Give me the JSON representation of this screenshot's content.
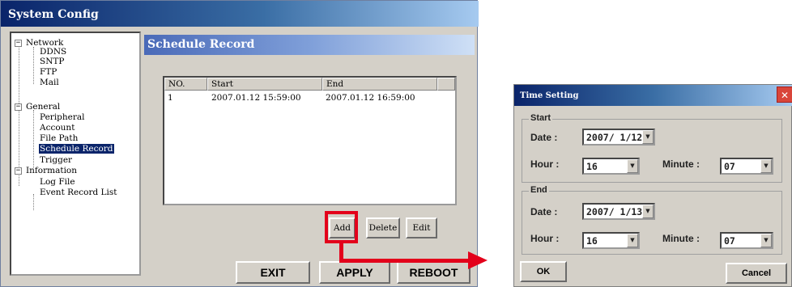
{
  "system_config": {
    "title": "System Config",
    "tree": [
      {
        "label": "Network",
        "level": 0,
        "toggle": "−"
      },
      {
        "label": "DDNS",
        "level": 1
      },
      {
        "label": "SNTP",
        "level": 1
      },
      {
        "label": "FTP",
        "level": 1
      },
      {
        "label": "Mail",
        "level": 1
      },
      {
        "label": "General",
        "level": 0,
        "toggle": "−"
      },
      {
        "label": "Peripheral",
        "level": 1
      },
      {
        "label": "Account",
        "level": 1
      },
      {
        "label": "File Path",
        "level": 1
      },
      {
        "label": "Schedule Record",
        "level": 1,
        "selected": true
      },
      {
        "label": "Trigger",
        "level": 1
      },
      {
        "label": "Information",
        "level": 0,
        "toggle": "−"
      },
      {
        "label": "Log File",
        "level": 1
      },
      {
        "label": "Event Record List",
        "level": 1
      }
    ],
    "panel_title": "Schedule Record",
    "table": {
      "columns": [
        "NO.",
        "Start",
        "End",
        ""
      ],
      "rows": [
        [
          "1",
          "2007.01.12 15:59:00",
          "2007.01.12 16:59:00"
        ]
      ]
    },
    "buttons": {
      "add": "Add",
      "delete": "Delete",
      "edit": "Edit",
      "exit": "EXIT",
      "apply": "APPLY",
      "reboot": "REBOOT"
    },
    "highlight_color": "#e3001b"
  },
  "time_setting": {
    "title": "Time Setting",
    "close": "✕",
    "start": {
      "group_label": "Start",
      "date_label": "Date :",
      "date_value": "2007/ 1/12",
      "hour_label": "Hour :",
      "hour_value": "16",
      "minute_label": "Minute :",
      "minute_value": "07"
    },
    "end": {
      "group_label": "End",
      "date_label": "Date :",
      "date_value": "2007/ 1/13",
      "hour_label": "Hour :",
      "hour_value": "16",
      "minute_label": "Minute :",
      "minute_value": "07"
    },
    "ok": "OK",
    "cancel": "Cancel"
  }
}
